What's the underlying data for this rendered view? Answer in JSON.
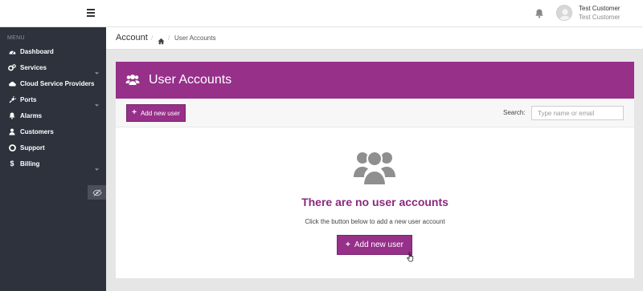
{
  "header": {
    "user_name": "Test Customer",
    "user_role": "Test Customer"
  },
  "sidebar": {
    "menu_label": "MENU",
    "items": [
      {
        "label": "Dashboard",
        "icon": "dashboard-icon",
        "has_submenu": false
      },
      {
        "label": "Services",
        "icon": "cogs-icon",
        "has_submenu": true
      },
      {
        "label": "Cloud Service Providers",
        "icon": "cloud-icon",
        "has_submenu": false
      },
      {
        "label": "Ports",
        "icon": "plug-icon",
        "has_submenu": true
      },
      {
        "label": "Alarms",
        "icon": "bell-icon",
        "has_submenu": false
      },
      {
        "label": "Customers",
        "icon": "user-icon",
        "has_submenu": false
      },
      {
        "label": "Support",
        "icon": "life-ring-icon",
        "has_submenu": false
      },
      {
        "label": "Billing",
        "icon": "dollar-icon",
        "has_submenu": true
      }
    ]
  },
  "breadcrumb": {
    "title": "Account",
    "separator": "/",
    "current": "User Accounts"
  },
  "panel": {
    "title": "User Accounts",
    "add_button_label": "Add new user",
    "search_label": "Search:",
    "search_placeholder": "Type name or email",
    "empty_title": "There are no user accounts",
    "empty_subtitle": "Click the button below to add a new user account",
    "empty_button_label": "Add new user"
  },
  "colors": {
    "brand": "#963089",
    "sidebar": "#2d323c",
    "empty_icon": "#8f8f8f"
  }
}
